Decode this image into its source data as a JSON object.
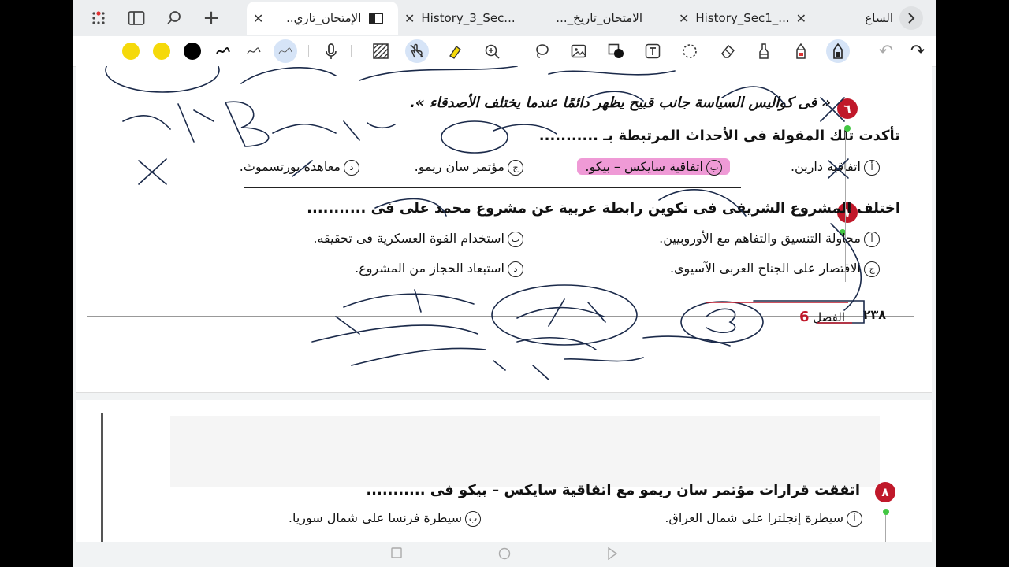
{
  "tabs": [
    {
      "label": "الساع",
      "close": "✕"
    },
    {
      "label": "History_Sec1_...",
      "close": "✕"
    },
    {
      "label": "الامتحان_تاريخ_...",
      "close": "✕"
    },
    {
      "label": "History_3_Sec...",
      "close": "✕"
    },
    {
      "label": "الإمتحان_تاري..",
      "close": "✕"
    }
  ],
  "toolbar": {
    "colors": [
      "#f5d90a",
      "#f5d90a",
      "#000000"
    ],
    "undo": "↶",
    "redo": "↷"
  },
  "page1": {
    "q6": {
      "num": "٦",
      "line1": "« فى كواليس السياسة جانب قبيح يظهر دائمًا عندما يختلف الأصدقاء ».",
      "line2": "تأكدت تلك المقولة فى الأحداث المرتبطة بـ ...........",
      "opts": [
        {
          "letter": "أ",
          "text": "اتفاقية دارين."
        },
        {
          "letter": "ب",
          "text": "اتفاقية سايكس – بيكو."
        },
        {
          "letter": "ج",
          "text": "مؤتمر سان ريمو."
        },
        {
          "letter": "د",
          "text": "معاهدة بورتسموث."
        }
      ]
    },
    "q7": {
      "num": "٧",
      "line1": "اختلف المشروع الشريفى فى تكوين رابطة عربية عن مشروع محمد على فى ...........",
      "opts": [
        {
          "letter": "أ",
          "text": "محاولة التنسيق والتفاهم مع الأوروبيين."
        },
        {
          "letter": "ب",
          "text": "استخدام القوة العسكرية فى تحقيقه."
        },
        {
          "letter": "ج",
          "text": "الاقتصار على الجناح العربى الآسيوى."
        },
        {
          "letter": "د",
          "text": "استبعاد الحجاز من المشروع."
        }
      ]
    },
    "footer": {
      "chapter": "الفصل",
      "chapter_num": "6",
      "page": "٢٣٨"
    }
  },
  "page2": {
    "q8": {
      "num": "٨",
      "line1": "اتفقت قرارات مؤتمر سان ريمو مع اتفاقية سايكس – بيكو فى ...........",
      "opts": [
        {
          "letter": "أ",
          "text": "سيطرة إنجلترا على شمال العراق."
        },
        {
          "letter": "ب",
          "text": "سيطرة فرنسا على شمال سوريا."
        }
      ]
    }
  }
}
